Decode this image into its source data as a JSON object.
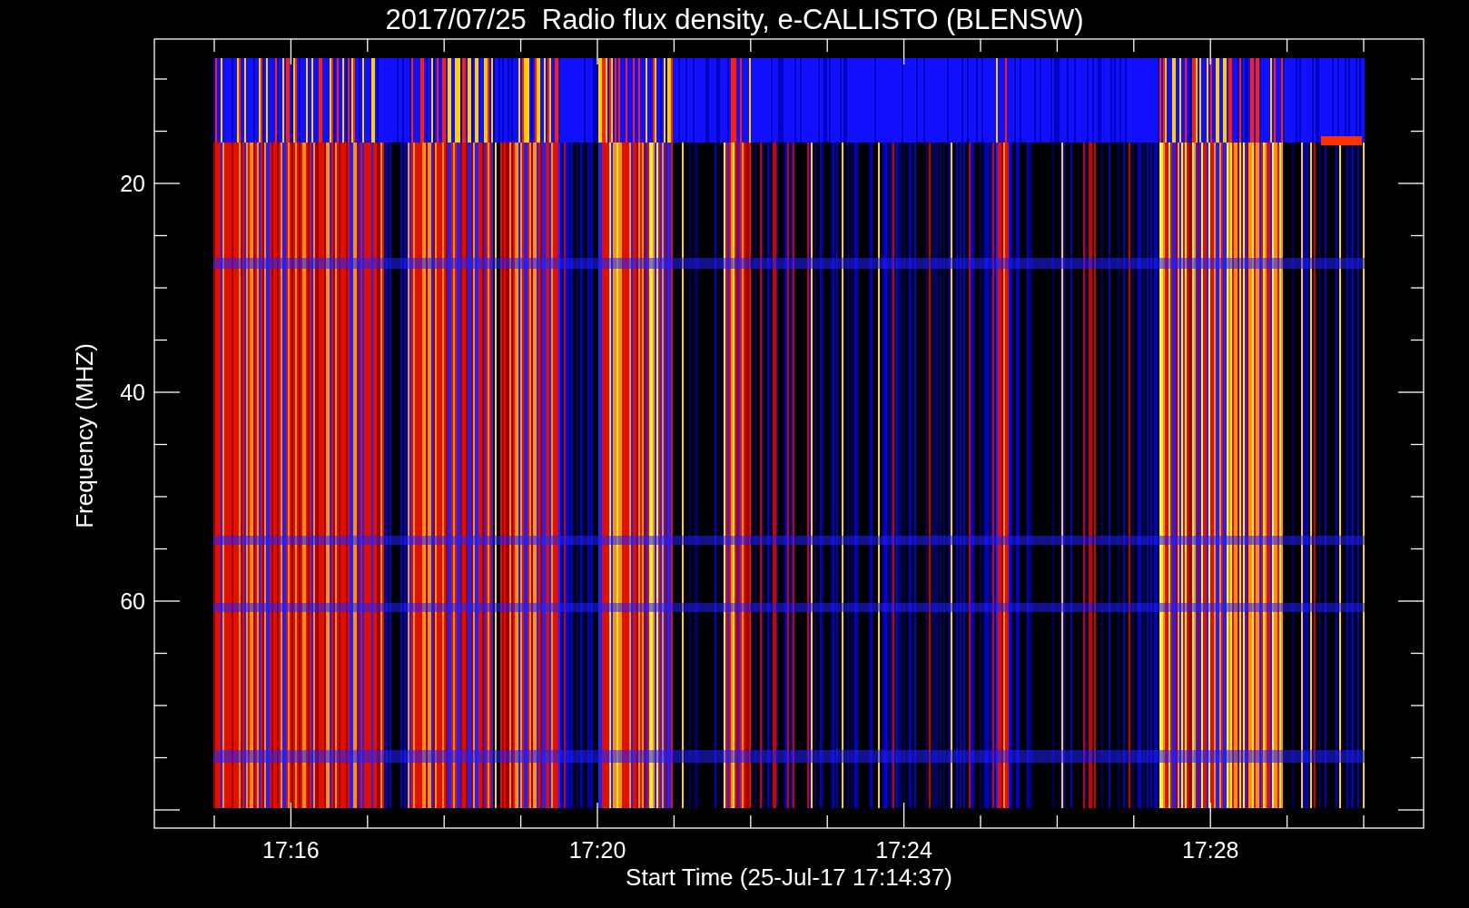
{
  "plot": {
    "title": "2017/07/25  Radio flux density, e-CALLISTO (BLENSW)",
    "xlabel": "Start Time (25-Jul-17 17:14:37)",
    "ylabel": "Frequency (MHZ)",
    "x_tick_labels": [
      "17:16",
      "17:20",
      "17:24",
      "17:28"
    ],
    "y_tick_labels": [
      "20",
      "40",
      "60"
    ]
  }
}
